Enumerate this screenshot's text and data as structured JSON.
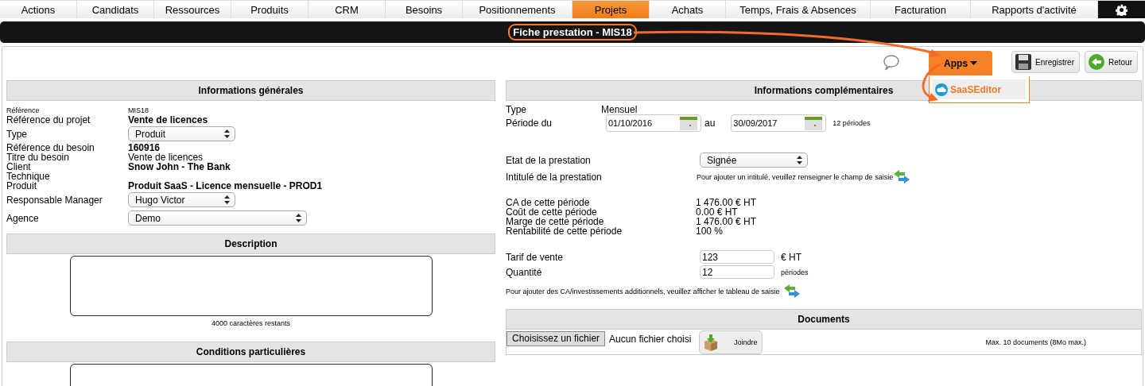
{
  "nav": [
    {
      "label": "Actions",
      "selected": false
    },
    {
      "label": "Candidats",
      "selected": false
    },
    {
      "label": "Ressources",
      "selected": false
    },
    {
      "label": "Produits",
      "selected": false
    },
    {
      "label": "CRM",
      "selected": false
    },
    {
      "label": "Besoins",
      "selected": false
    },
    {
      "label": "Positionnements",
      "selected": false
    },
    {
      "label": "Projets",
      "selected": true
    },
    {
      "label": "Achats",
      "selected": false
    },
    {
      "label": "Temps, Frais & Absences",
      "selected": false
    },
    {
      "label": "Facturation",
      "selected": false
    },
    {
      "label": "Rapports d'activité",
      "selected": false
    }
  ],
  "title": "Fiche prestation - MIS18",
  "apps_menu": {
    "label": "Apps",
    "expanded": true,
    "items": [
      {
        "label": "SaaSEditor"
      }
    ]
  },
  "buttons": [
    {
      "kind": "save",
      "label": "Enregistrer"
    },
    {
      "kind": "back",
      "label": "Retour"
    }
  ],
  "general": {
    "title": "Informations générales",
    "rows": [
      {
        "kind": "small",
        "label": "Référence",
        "value": "MIS18"
      },
      {
        "kind": "bold",
        "label": "Référence du projet",
        "value": "Vente de licences"
      },
      {
        "kind": "select",
        "label": "Type",
        "value": "Produit",
        "wide": false
      },
      {
        "kind": "bold",
        "label": "Référence du besoin",
        "value": "160916"
      },
      {
        "kind": "text",
        "label": "Titre du besoin",
        "value": "Vente de licences"
      },
      {
        "kind": "bold",
        "label": "Client",
        "value": "Snow John - The Bank"
      },
      {
        "kind": "text",
        "label": "Technique"
      },
      {
        "kind": "bold",
        "label": "Produit",
        "value": "Produit SaaS - Licence mensuelle - PROD1"
      },
      {
        "kind": "select",
        "label": "Responsable Manager",
        "value": "Hugo Victor",
        "wide": false
      },
      {
        "kind": "select",
        "label": "Agence",
        "value": "Demo",
        "wide": true
      }
    ]
  },
  "description": {
    "title": "Description",
    "counter": "4000 caractères restants"
  },
  "conditions": {
    "title": "Conditions particulières"
  },
  "complement": {
    "title": "Informations complémentaires",
    "type_label": "Type",
    "type_value": "Mensuel",
    "period_label": "Période du",
    "start": "01/10/2016",
    "to_label": "au",
    "end": "30/09/2017",
    "periods": "12 périodes",
    "etat_label": "Etat de la prestation",
    "etat_value": "Signée",
    "intitule_label": "Intitulé de la prestation",
    "intitule_hint": "Pour ajouter un intitulé, veuillez renseigner le champ de saisie",
    "figures": [
      {
        "label": "CA de cette période",
        "value": "1 476.00 € HT"
      },
      {
        "label": "Coût de cette période",
        "value": "0.00 € HT"
      },
      {
        "label": "Marge de cette période",
        "value": "1 476.00 € HT"
      },
      {
        "label": "Rentabilité de cette période",
        "value": "100 %"
      }
    ],
    "tarif_label": "Tarif de vente",
    "tarif_value": "123",
    "tarif_unit": "€ HT",
    "qty_label": "Quantité",
    "qty_value": "12",
    "qty_unit": "périodes",
    "additional_hint": "Pour ajouter des CA/investissements additionnels, veuillez afficher le tableau de saisie"
  },
  "documents": {
    "title": "Documents",
    "file_button": "Choisissez un fichier",
    "file_status": "Aucun fichier choisi",
    "attach_button": "Joindre",
    "limit": "Max. 10 documents (8Mo max.)"
  }
}
